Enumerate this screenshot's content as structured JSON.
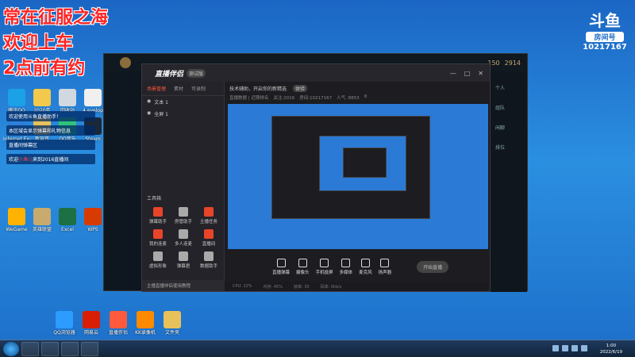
{
  "overlay": {
    "line1": "常在征服之海",
    "line2": "欢迎上车",
    "line3": "2点前有约"
  },
  "room_logo": {
    "glyph": "斗鱼",
    "badge": "房间号",
    "number": "10217167"
  },
  "desktop_icons_left": [
    {
      "label": "腾讯QQ",
      "color": "#1aa1e6"
    },
    {
      "label": "2020年",
      "color": "#f2c94c"
    },
    {
      "label": "回收站",
      "color": "#d0d8e0"
    },
    {
      "label": "4.evelop",
      "color": "#f0f0f0"
    },
    {
      "label": "Internet Explorer",
      "color": "#2e7fd8"
    },
    {
      "label": "新宣传",
      "color": "#e8c15a"
    },
    {
      "label": "QQ音乐",
      "color": "#31c27c"
    },
    {
      "label": "Steam",
      "color": "#1b2838"
    },
    {
      "label": "WeGame",
      "color": "#ffb300"
    },
    {
      "label": "英雄联盟",
      "color": "#c8aa6e"
    },
    {
      "label": "Excel",
      "color": "#1d7044"
    },
    {
      "label": "WPS",
      "color": "#d83b01"
    }
  ],
  "desktop_icons_bottom": [
    {
      "label": "QQ浏览器",
      "color": "#2c9cff"
    },
    {
      "label": "网易云",
      "color": "#d81e06"
    },
    {
      "label": "直播伴侣",
      "color": "#ff5a3c"
    },
    {
      "label": "KK录像机",
      "color": "#ff8a00"
    },
    {
      "label": "文件夹",
      "color": "#e8c15a"
    }
  ],
  "game_topbar": {
    "value1": "150",
    "value2": "2914"
  },
  "app": {
    "title": "直播伴侣",
    "version": "测试版",
    "tabs": [
      "场景管理",
      "素材",
      "可录制"
    ],
    "sources": [
      "文本 1",
      "全屏 1"
    ],
    "tool_title": "工具箱",
    "tools": [
      {
        "label": "弹幕助手",
        "color": "#e8442a"
      },
      {
        "label": "房管助手",
        "color": "#aaaaaa"
      },
      {
        "label": "主播任务",
        "color": "#e8442a"
      },
      {
        "label": "我的连麦",
        "color": "#e8442a"
      },
      {
        "label": "多人连麦",
        "color": "#aaaaaa"
      },
      {
        "label": "直播间",
        "color": "#e8442a"
      },
      {
        "label": "虚拟形象",
        "color": "#aaaaaa"
      },
      {
        "label": "弹幕君",
        "color": "#aaaaaa"
      },
      {
        "label": "数据助手",
        "color": "#aaaaaa"
      }
    ],
    "footer": "主播直播伴侣使用教程",
    "notice": [
      "技术辅助，开启你的新精选",
      "体验"
    ],
    "stats": [
      "直播数据 | 近期排名",
      "关注:2016",
      "房间:10217167",
      "人气: 8853",
      "8"
    ],
    "bottom_tools": [
      "直播弹幕",
      "摄像头",
      "手机投屏",
      "多媒体",
      "麦克风",
      "扬声器"
    ],
    "go_live": "开始直播",
    "status": [
      "CPU: 22%",
      "内存: 45%",
      "帧率: 30",
      "码率: 0kb/s"
    ]
  },
  "chat": [
    {
      "text": "欢迎使用斗鱼直播助手！",
      "highlight": ""
    },
    {
      "text": "本区域会显示弹幕和礼物信息",
      "highlight": ""
    },
    {
      "text": "直播间弹幕区",
      "highlight": ""
    },
    {
      "text": "欢迎",
      "highlight": "小渔儿",
      "suffix": "来到2016直播间"
    }
  ],
  "side_panel": [
    "个人",
    "组队",
    "闲聊",
    "排位"
  ],
  "taskbar": {
    "time": "1:00",
    "date": "2022/6/19"
  }
}
